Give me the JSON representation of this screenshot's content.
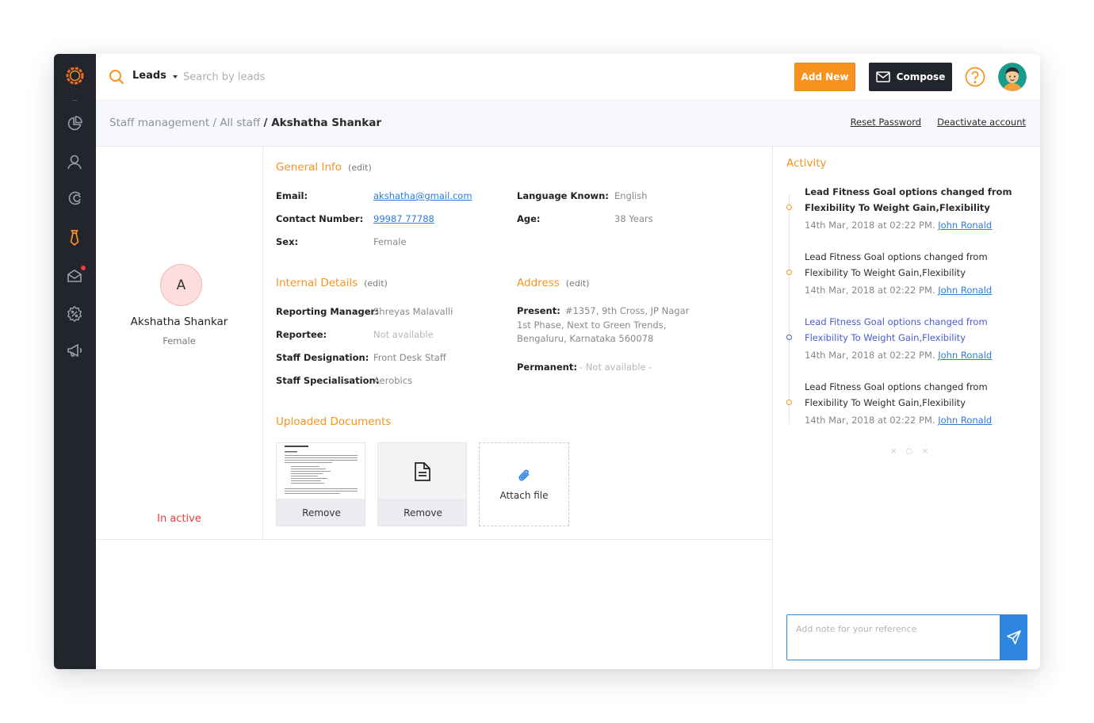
{
  "colors": {
    "accent": "#f7931e",
    "sidebar": "#23252d",
    "link": "#2f7bd8",
    "danger": "#ee3b3b",
    "highlight": "#4b5bd0"
  },
  "sidebar": {
    "icons": [
      "logo-icon",
      "dashboard-icon",
      "user-icon",
      "magnet-icon",
      "tie-icon",
      "inbox-icon",
      "settings-percent-icon",
      "megaphone-icon"
    ]
  },
  "topbar": {
    "module": "Leads",
    "search_placeholder": "Search by leads",
    "add_new": "Add New",
    "compose": "Compose"
  },
  "breadcrumb": {
    "level1": "Staff management",
    "level2": "All staff",
    "current": "Akshatha Shankar",
    "reset_password": "Reset Password",
    "deactivate": "Deactivate account"
  },
  "profile": {
    "initial": "A",
    "name": "Akshatha Shankar",
    "sex": "Female",
    "status": "In active"
  },
  "general_info": {
    "title": "General Info",
    "edit": "(edit)",
    "email_label": "Email:",
    "email": "akshatha@gmail.com",
    "contact_label": "Contact Number:",
    "contact": "99987 77788",
    "sex_label": "Sex:",
    "sex": "Female",
    "language_label": "Language Known:",
    "language": "English",
    "age_label": "Age:",
    "age": "38 Years"
  },
  "internal_details": {
    "title": "Internal Details",
    "edit": "(edit)",
    "manager_label": "Reporting Manager:",
    "manager": "Shreyas Malavalli",
    "reportee_label": "Reportee:",
    "reportee": "Not available",
    "designation_label": "Staff Designation:",
    "designation": "Front Desk Staff",
    "specialisation_label": "Staff Specialisation:",
    "specialisation": "Aerobics"
  },
  "address": {
    "title": "Address",
    "edit": "(edit)",
    "present_label": "Present:",
    "present": "#1357, 9th Cross, JP Nagar 1st Phase, Next to Green Trends, Bengaluru, Karnataka 560078",
    "permanent_label": "Permanent:",
    "permanent": "- Not available -"
  },
  "documents": {
    "title": "Uploaded Documents",
    "remove": "Remove",
    "attach": "Attach file"
  },
  "activity": {
    "title": "Activity",
    "items": [
      {
        "text": "Lead Fitness Goal options changed from Flexibility To Weight Gain,Flexibility",
        "time": "14th Mar, 2018 at 02:22 PM.",
        "user": "John Ronald"
      },
      {
        "text": "Lead Fitness Goal options changed from Flexibility To Weight Gain,Flexibility",
        "time": "14th Mar, 2018 at 02:22 PM.",
        "user": "John Ronald"
      },
      {
        "text": "Lead Fitness Goal options changed from Flexibility To Weight Gain,Flexibility",
        "time": "14th Mar, 2018 at 02:22 PM.",
        "user": "John Ronald"
      },
      {
        "text": "Lead Fitness Goal options changed from Flexibility To Weight Gain,Flexibility",
        "time": "14th Mar, 2018 at 02:22 PM.",
        "user": "John Ronald"
      }
    ],
    "loader": "× ○ ×",
    "note_placeholder": "Add note for your reference"
  }
}
